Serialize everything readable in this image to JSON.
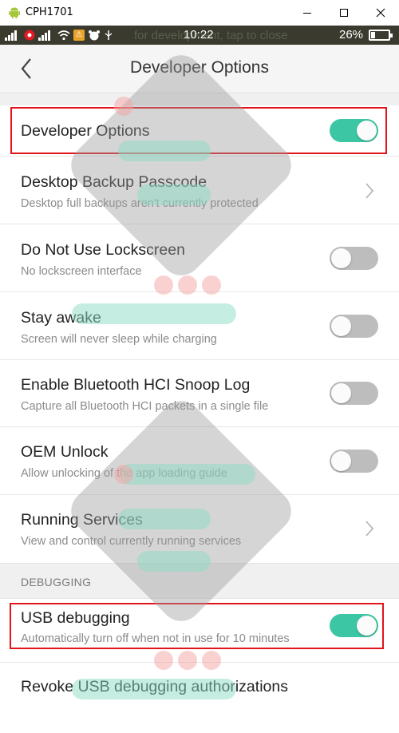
{
  "window": {
    "title": "CPH1701",
    "controls": {
      "minimize_icon": "minimize-icon",
      "maximize_icon": "maximize-icon",
      "close_icon": "close-icon"
    }
  },
  "statusbar": {
    "notification_ghost": "for development, tap to close",
    "time": "10:22",
    "battery": "26%",
    "battery_level": 0.26
  },
  "toolbar": {
    "title": "Developer Options",
    "back_icon": "chevron-left-icon"
  },
  "settings": {
    "developer_options": {
      "title": "Developer Options",
      "toggle": true
    },
    "desktop_backup": {
      "title": "Desktop Backup Passcode",
      "subtitle": "Desktop full backups aren't currently protected"
    },
    "lockscreen": {
      "title": "Do Not Use Lockscreen",
      "subtitle": "No lockscreen interface",
      "toggle": false
    },
    "stay_awake": {
      "title": "Stay awake",
      "subtitle": "Screen will never sleep while charging",
      "toggle": false
    },
    "bt_snoop": {
      "title": "Enable Bluetooth HCI Snoop Log",
      "subtitle": "Capture all Bluetooth HCI packets in a single file",
      "toggle": false
    },
    "oem_unlock": {
      "title": "OEM Unlock",
      "subtitle": "Allow unlocking of the app loading guide",
      "toggle": false
    },
    "running_services": {
      "title": "Running Services",
      "subtitle": "View and control currently running services"
    },
    "debugging_section": "DEBUGGING",
    "usb_debugging": {
      "title": "USB debugging",
      "subtitle": "Automatically turn off when not in use for 10 minutes",
      "toggle": true
    },
    "revoke_usb": {
      "title": "Revoke USB debugging authorizations"
    }
  },
  "colors": {
    "toggle_on": "#3cc6a3",
    "toggle_off": "#bdbdbd",
    "highlight": "#e3141b",
    "statusbar_bg": "#3a3a2e"
  }
}
